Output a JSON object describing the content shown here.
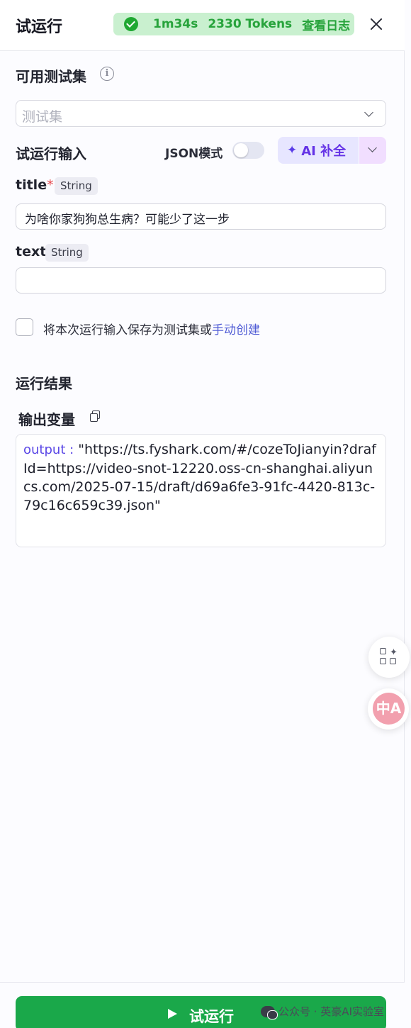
{
  "header": {
    "title": "试运行",
    "duration": "1m34s",
    "tokens": "2330 Tokens",
    "view_log": "查看日志",
    "status_color": "#1fa832"
  },
  "test_set": {
    "label": "可用测试集",
    "placeholder": "测试集"
  },
  "run_input": {
    "label": "试运行输入",
    "json_mode_label": "JSON模式",
    "json_mode_on": false,
    "ai_fill_label": "AI 补全"
  },
  "fields": [
    {
      "name": "title",
      "required": true,
      "type": "String",
      "value": "为啥你家狗狗总生病？可能少了这一步"
    },
    {
      "name": "text",
      "required": false,
      "type": "String",
      "value": ""
    }
  ],
  "save_option": {
    "checked": false,
    "text": "将本次运行输入保存为测试集或",
    "link": "手动创建"
  },
  "result": {
    "section_label": "运行结果",
    "output_label": "输出变量",
    "output_key": "output :",
    "output_value": "\"https://ts.fyshark.com/#/cozeToJianyin?drafId=https://video-snot-12220.oss-cn-shanghai.aliyuncs.com/2025-07-15/draft/d69a6fe3-91fc-4420-813c-79c16c659c39.json\""
  },
  "floating": {
    "translate_glyph": "中A"
  },
  "footer": {
    "run_label": "试运行",
    "accent": "#1aa84a"
  },
  "watermark": "公众号 · 英豪AI实验室"
}
